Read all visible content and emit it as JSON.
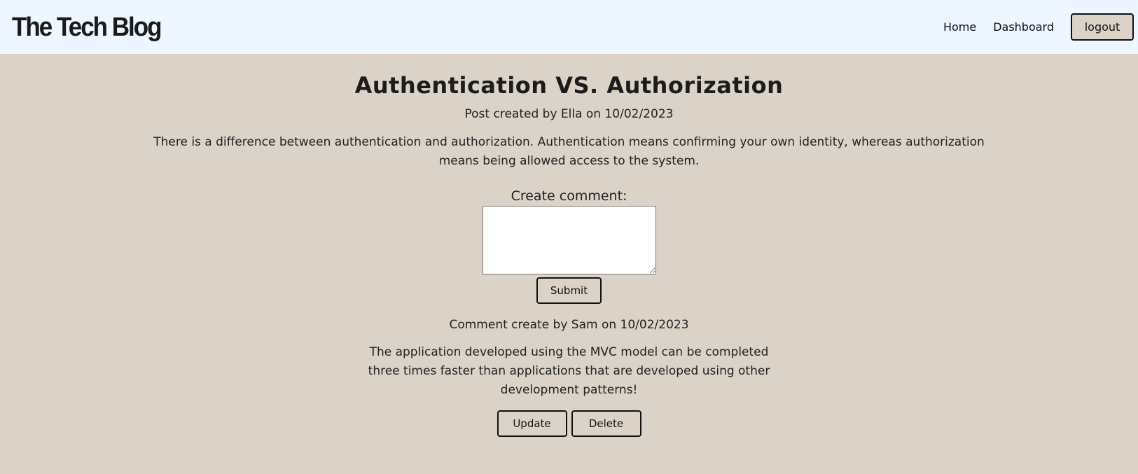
{
  "header": {
    "logo": "The Tech Blog",
    "nav": {
      "home": "Home",
      "dashboard": "Dashboard",
      "logout": "logout"
    }
  },
  "post": {
    "title": "Authentication VS. Authorization",
    "meta": "Post created by Ella on 10/02/2023",
    "body": "There is a difference between authentication and authorization. Authentication means confirming your own identity, whereas authorization means being allowed access to the system."
  },
  "comment_form": {
    "label": "Create comment:",
    "value": "",
    "submit": "Submit"
  },
  "comment": {
    "meta": "Comment create by Sam on 10/02/2023",
    "body": "The application developed using the MVC model can be completed three times faster than applications that are developed using other development patterns!",
    "update": "Update",
    "delete": "Delete"
  },
  "colors": {
    "background": "#dbd3c8",
    "header_background": "#eef6ff"
  }
}
